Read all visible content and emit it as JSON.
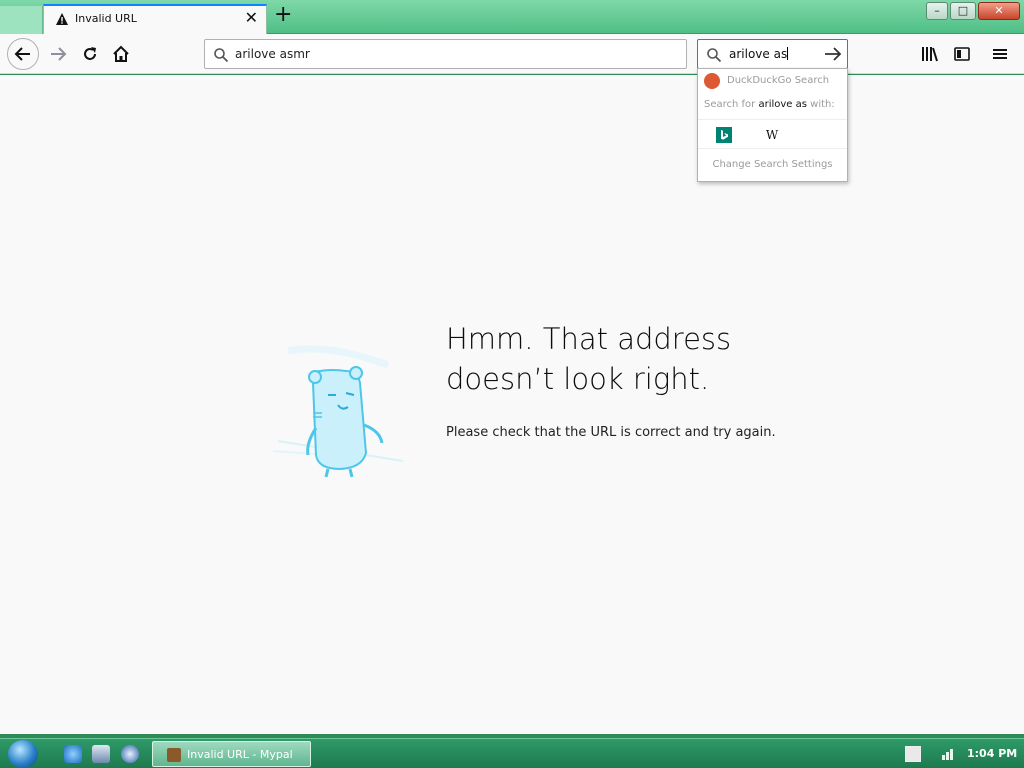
{
  "window": {
    "tab_title": "Invalid URL",
    "new_tab_label": "+",
    "close_tab_label": "✕",
    "minimize_label": "–",
    "maximize_label": "□",
    "close_label": "✕"
  },
  "toolbar": {
    "url_value": "arilove asmr",
    "search_value": "arilove as"
  },
  "search_dropdown": {
    "engine_name": "DuckDuckGo Search",
    "search_for_prefix": "Search for ",
    "search_for_query": "arilove as",
    "search_for_suffix": " with:",
    "wiki_label": "W",
    "settings_label": "Change Search Settings"
  },
  "error_page": {
    "title_line1": "Hmm. That address",
    "title_line2": "doesn’t look right.",
    "description": "Please check that the URL is correct and try again."
  },
  "taskbar": {
    "task_label": "Invalid URL - Mypal",
    "clock": "1:04 PM"
  },
  "colors": {
    "accent": "#0a84ff",
    "taskbar": "#2e8b57",
    "content_bg": "#f9f9fa"
  }
}
